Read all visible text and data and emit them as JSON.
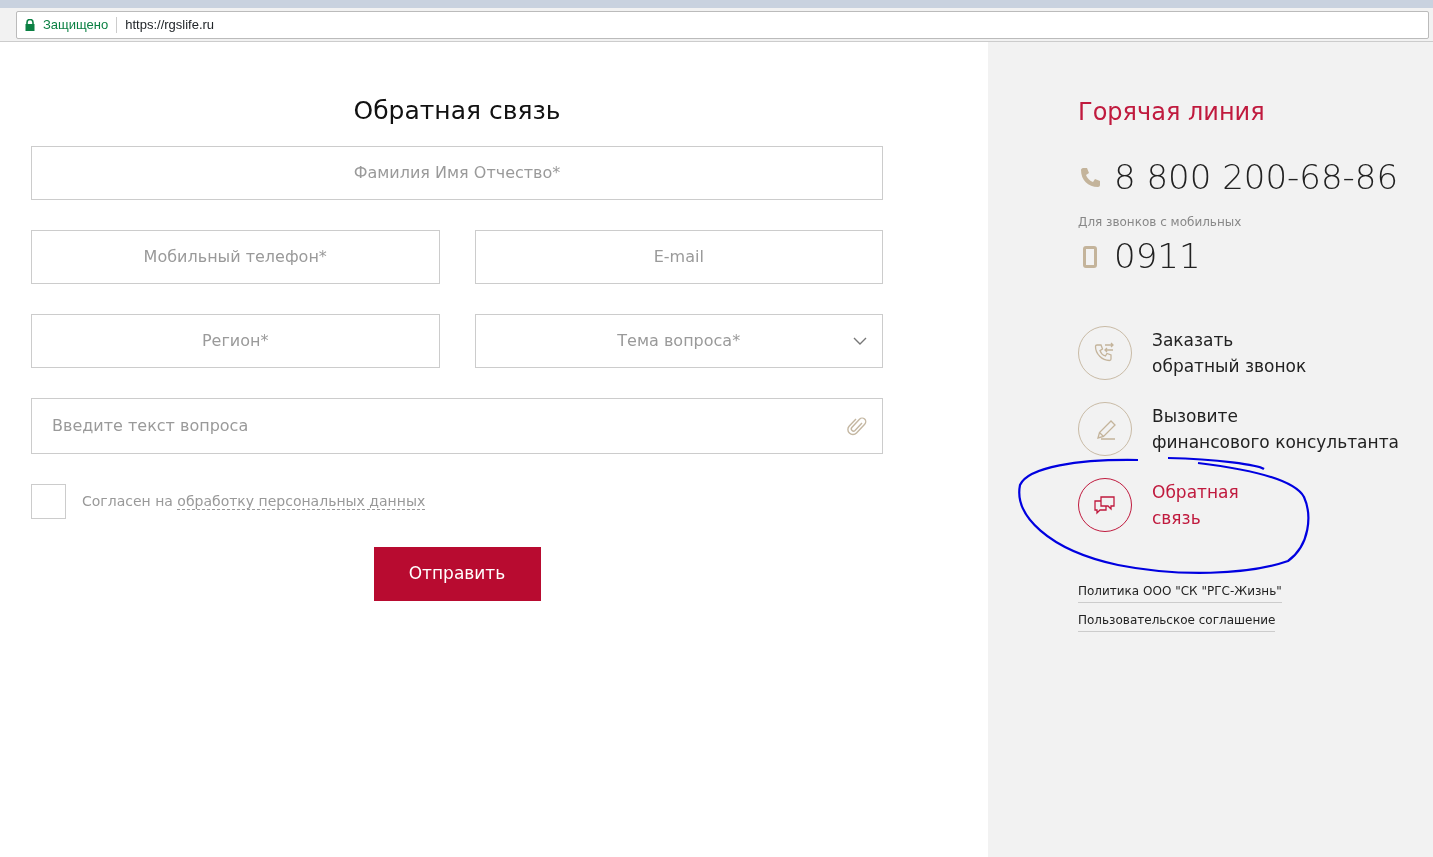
{
  "browser": {
    "secure_label": "Защищено",
    "url": "https://rgslife.ru"
  },
  "form": {
    "title": "Обратная связь",
    "rows": [
      {
        "fields": [
          {
            "kind": "text",
            "placeholder": "Фамилия Имя Отчество*"
          }
        ]
      },
      {
        "fields": [
          {
            "kind": "text",
            "placeholder": "Мобильный телефон*"
          },
          {
            "kind": "text",
            "placeholder": "E-mail"
          }
        ]
      },
      {
        "fields": [
          {
            "kind": "text",
            "placeholder": "Регион*"
          },
          {
            "kind": "select",
            "placeholder": "Тема вопроса*"
          }
        ]
      },
      {
        "fields": [
          {
            "kind": "textarea",
            "placeholder": "Введите текст вопроса"
          }
        ]
      }
    ],
    "consent": {
      "checked": false,
      "text": "Согласен на",
      "link": "обработку персональных данных"
    },
    "submit": "Отправить"
  },
  "sidebar": {
    "title": "Горячая линия",
    "phones": [
      {
        "kind": "landline",
        "number": "8 800 200-68-86"
      },
      {
        "kind": "mobile",
        "note": "Для звонков с мобильных",
        "number": "0911"
      }
    ],
    "actions": [
      {
        "kind": "callback",
        "lines": [
          "Заказать",
          "обратный звонок"
        ],
        "selected": false
      },
      {
        "kind": "consultant",
        "lines": [
          "Вызовите",
          "финансового консультанта"
        ],
        "selected": false
      },
      {
        "kind": "feedback",
        "lines": [
          "Обратная",
          "связь"
        ],
        "selected": true
      }
    ],
    "links": [
      "Политика ООО \"СК \"РГС-Жизнь\"",
      "Пользовательское соглашение"
    ]
  }
}
